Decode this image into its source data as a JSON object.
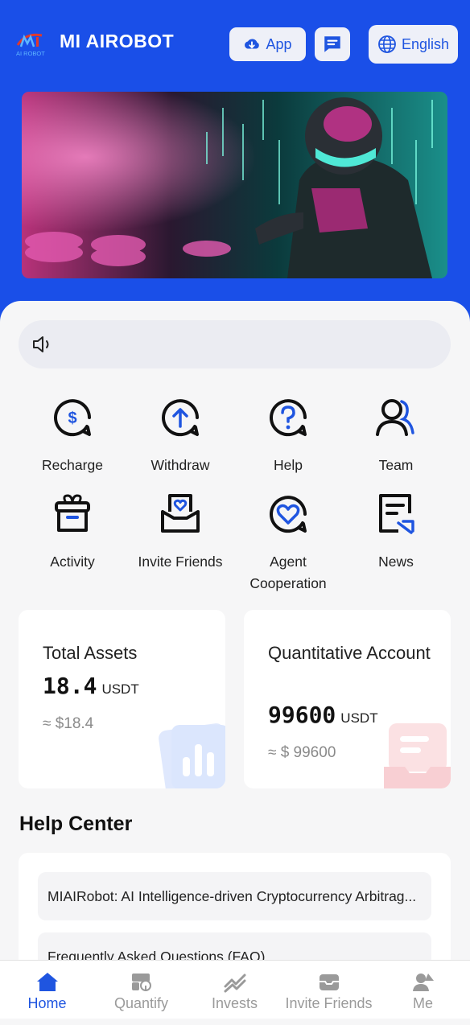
{
  "header": {
    "brand": "MI AIROBOT",
    "logo_text": "AI ROBOT",
    "app_label": "App",
    "language_label": "English"
  },
  "notice": {
    "icon": "speaker-icon"
  },
  "quick_actions": [
    {
      "label": "Recharge",
      "icon": "dollar-recharge-icon"
    },
    {
      "label": "Withdraw",
      "icon": "arrow-up-withdraw-icon"
    },
    {
      "label": "Help",
      "icon": "question-icon"
    },
    {
      "label": "Team",
      "icon": "team-icon"
    },
    {
      "label": "Activity",
      "icon": "gift-icon"
    },
    {
      "label": "Invite Friends",
      "icon": "envelope-heart-icon"
    },
    {
      "label": "Agent Cooperation",
      "icon": "heart-circle-icon"
    },
    {
      "label": "News",
      "icon": "news-icon"
    }
  ],
  "assets": {
    "total": {
      "title": "Total Assets",
      "value": "18.4",
      "unit": "USDT",
      "approx": "≈ $18.4"
    },
    "quant": {
      "title": "Quantitative Account",
      "value": "99600",
      "unit": "USDT",
      "approx": "≈ $ 99600"
    }
  },
  "help_center": {
    "title": "Help Center",
    "items": [
      "MIAIRobot: AI Intelligence-driven Cryptocurrency Arbitrag...",
      "Frequently Asked Questions (FAQ)"
    ]
  },
  "tabbar": [
    {
      "label": "Home",
      "icon": "home-icon",
      "active": true
    },
    {
      "label": "Quantify",
      "icon": "quantify-icon",
      "active": false
    },
    {
      "label": "Invests",
      "icon": "invests-chart-icon",
      "active": false
    },
    {
      "label": "Invite Friends",
      "icon": "invite-box-icon",
      "active": false
    },
    {
      "label": "Me",
      "icon": "user-icon",
      "active": false
    }
  ],
  "colors": {
    "primary": "#1a4fe8",
    "accent": "#1f55e0",
    "panel": "#f6f6f7"
  }
}
